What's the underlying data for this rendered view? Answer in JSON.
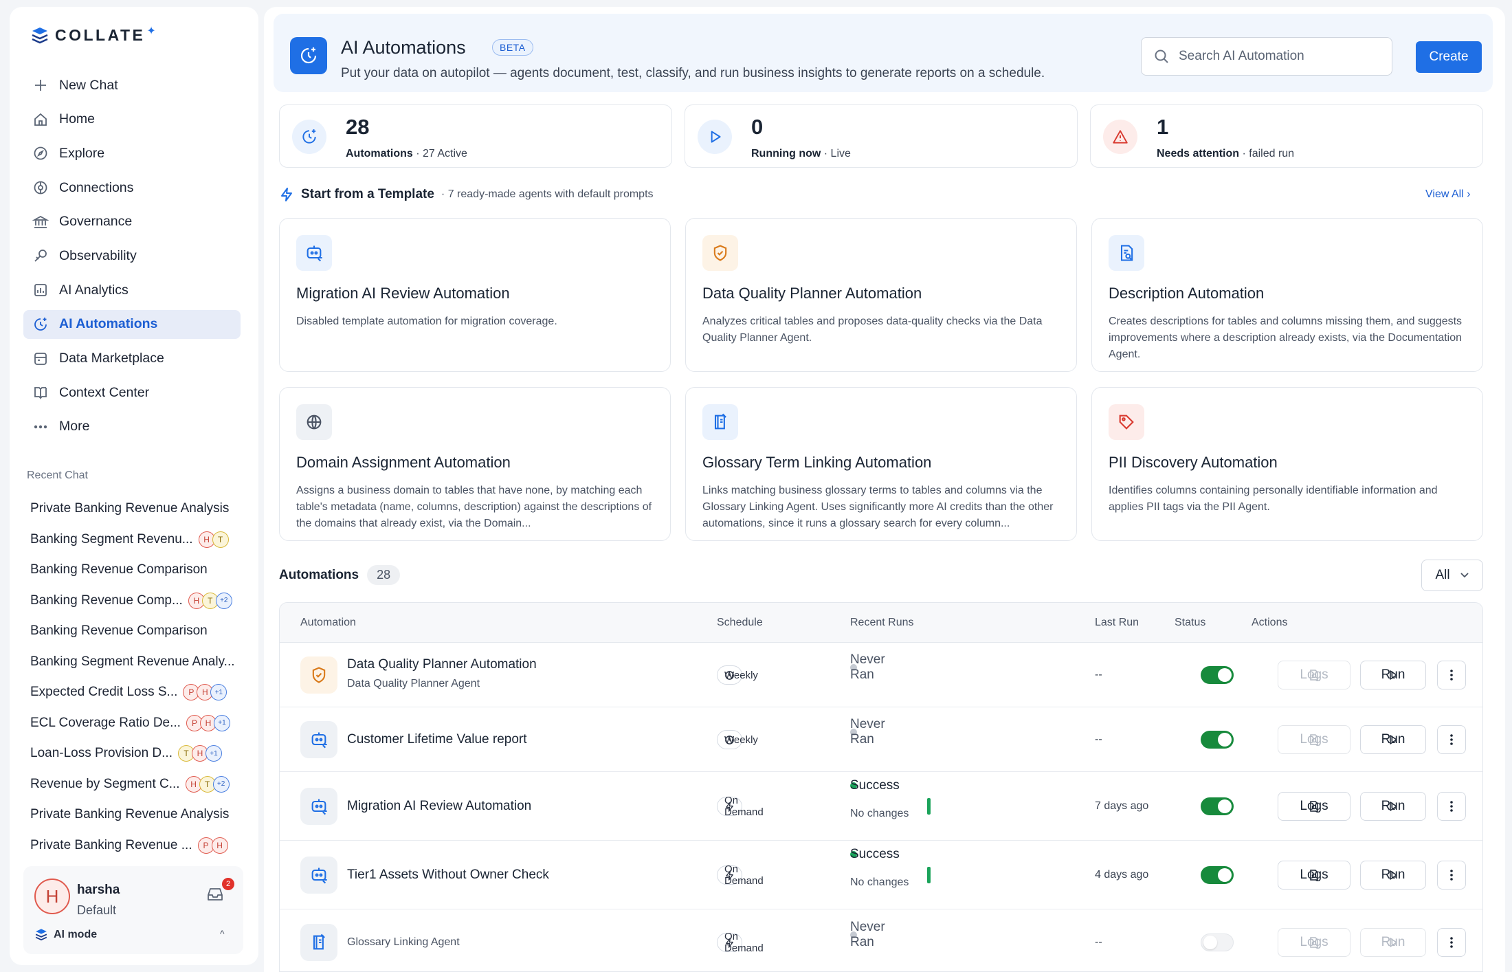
{
  "brand": {
    "name": "COLLATE",
    "star": "✦"
  },
  "nav": [
    {
      "label": "New Chat",
      "icon": "plus-icon"
    },
    {
      "label": "Home",
      "icon": "home-icon"
    },
    {
      "label": "Explore",
      "icon": "compass-icon"
    },
    {
      "label": "Connections",
      "icon": "connections-icon"
    },
    {
      "label": "Governance",
      "icon": "bank-icon"
    },
    {
      "label": "Observability",
      "icon": "telescope-icon"
    },
    {
      "label": "AI Analytics",
      "icon": "analytics-icon"
    },
    {
      "label": "AI Automations",
      "icon": "automation-clock-icon",
      "active": true
    },
    {
      "label": "Data Marketplace",
      "icon": "marketplace-icon"
    },
    {
      "label": "Context Center",
      "icon": "book-icon"
    },
    {
      "label": "More",
      "icon": "ellipsis-icon"
    }
  ],
  "recent_title": "Recent Chat",
  "recent": [
    {
      "label": "Private Banking Revenue Analysis",
      "avatars": []
    },
    {
      "label": "Banking Segment Revenu...",
      "avatars": [
        "H",
        "T"
      ]
    },
    {
      "label": "Banking Revenue Comparison",
      "avatars": []
    },
    {
      "label": "Banking Revenue Comp...",
      "avatars": [
        "H",
        "T",
        "+2"
      ]
    },
    {
      "label": "Banking Revenue Comparison",
      "avatars": []
    },
    {
      "label": "Banking Segment Revenue Analy...",
      "avatars": []
    },
    {
      "label": "Expected Credit Loss S...",
      "avatars": [
        "P",
        "H",
        "+1"
      ]
    },
    {
      "label": "ECL Coverage Ratio De...",
      "avatars": [
        "P",
        "H",
        "+1"
      ]
    },
    {
      "label": "Loan-Loss Provision D...",
      "avatars": [
        "T",
        "H",
        "+1"
      ]
    },
    {
      "label": "Revenue by Segment C...",
      "avatars": [
        "H",
        "T",
        "+2"
      ]
    },
    {
      "label": "Private Banking Revenue Analysis",
      "avatars": []
    },
    {
      "label": "Private Banking Revenue ...",
      "avatars": [
        "P",
        "H"
      ]
    }
  ],
  "user": {
    "initial": "H",
    "name": "harsha",
    "role": "Default",
    "inbox_count": "2",
    "mode": "AI mode"
  },
  "header": {
    "title": "AI Automations",
    "badge": "BETA",
    "subtitle": "Put your data on autopilot — agents document, test, classify, and run business insights to generate reports on a schedule.",
    "search_placeholder": "Search AI Automation",
    "create_label": "Create"
  },
  "stats": [
    {
      "value": "28",
      "label": "Automations",
      "detail": "· 27 Active",
      "icon": "automation-clock-icon",
      "color": "#1f6fe5",
      "bg": "#eaf2fd"
    },
    {
      "value": "0",
      "label": "Running now",
      "detail": "· Live",
      "icon": "play-icon",
      "color": "#1f6fe5",
      "bg": "#eaf2fd"
    },
    {
      "value": "1",
      "label": "Needs attention",
      "detail": "· failed run",
      "icon": "warning-icon",
      "color": "#d93a30",
      "bg": "#fdecea"
    }
  ],
  "templates_section": {
    "title": "Start from a Template",
    "subtitle": "· 7 ready-made agents with default prompts",
    "view_all": "View All"
  },
  "templates": [
    {
      "name": "Migration AI Review Automation",
      "desc": "Disabled template automation for migration coverage.",
      "icon": "bot-icon",
      "color": "#1f6fe5",
      "bg": "#eaf2fd"
    },
    {
      "name": "Data Quality Planner Automation",
      "desc": "Analyzes critical tables and proposes data-quality checks via the Data Quality Planner Agent.",
      "icon": "shield-check-icon",
      "color": "#d97a1a",
      "bg": "#fdf3e6"
    },
    {
      "name": "Description Automation",
      "desc": "Creates descriptions for tables and columns missing them, and suggests improvements where a description already exists, via the Documentation Agent.",
      "icon": "document-search-icon",
      "color": "#1f6fe5",
      "bg": "#eaf2fd"
    },
    {
      "name": "Domain Assignment Automation",
      "desc": "Assigns a business domain to tables that have none, by matching each table's metadata (name, columns, description) against the descriptions of the domains that already exist, via the Domain...",
      "icon": "globe-icon",
      "color": "#4a5363",
      "bg": "#eef1f5"
    },
    {
      "name": "Glossary Term Linking Automation",
      "desc": "Links matching business glossary terms to tables and columns via the Glossary Linking Agent. Uses significantly more AI credits than the other automations, since it runs a glossary search for every column...",
      "icon": "glossary-icon",
      "color": "#1f6fe5",
      "bg": "#eaf2fd"
    },
    {
      "name": "PII Discovery Automation",
      "desc": "Identifies columns containing personally identifiable information and applies PII tags via the PII Agent.",
      "icon": "tag-icon",
      "color": "#d93a30",
      "bg": "#fdecea"
    }
  ],
  "automations_section": {
    "title": "Automations",
    "count": "28",
    "filter": "All"
  },
  "columns": {
    "automation": "Automation",
    "schedule": "Schedule",
    "recent_runs": "Recent Runs",
    "last_run": "Last Run",
    "status": "Status",
    "actions": "Actions"
  },
  "rows": [
    {
      "name": "Data Quality Planner Automation",
      "agent": "Data Quality Planner Agent",
      "icon": "shield-check-icon",
      "color": "#d97a1a",
      "bg": "#fdf3e6",
      "schedule": "Weekly",
      "schedule_icon": "clock-icon",
      "run_state": "Never Ran",
      "run_detail": "",
      "last_run": "--",
      "enabled": true,
      "logs_enabled": false,
      "run_enabled": true
    },
    {
      "name": "Customer Lifetime Value report",
      "agent": "",
      "icon": "bot-icon",
      "color": "#1f6fe5",
      "bg": "#eef1f5",
      "schedule": "Weekly",
      "schedule_icon": "clock-icon",
      "run_state": "Never Ran",
      "run_detail": "",
      "last_run": "--",
      "enabled": true,
      "logs_enabled": false,
      "run_enabled": true
    },
    {
      "name": "Migration AI Review Automation",
      "agent": "",
      "icon": "bot-icon",
      "color": "#1f6fe5",
      "bg": "#eef1f5",
      "schedule": "On Demand",
      "schedule_icon": "bolt-icon",
      "run_state": "Success",
      "run_detail": "No changes",
      "last_run": "7 days ago",
      "enabled": true,
      "logs_enabled": true,
      "run_enabled": true
    },
    {
      "name": "Tier1 Assets Without Owner Check",
      "agent": "",
      "icon": "bot-icon",
      "color": "#1f6fe5",
      "bg": "#eef1f5",
      "schedule": "On Demand",
      "schedule_icon": "bolt-icon",
      "run_state": "Success",
      "run_detail": "No changes",
      "last_run": "4 days ago",
      "enabled": true,
      "logs_enabled": true,
      "run_enabled": true
    },
    {
      "name": "",
      "agent": "Glossary Linking Agent",
      "icon": "glossary-icon",
      "color": "#1f6fe5",
      "bg": "#eef1f5",
      "schedule": "On Demand",
      "schedule_icon": "bolt-icon",
      "run_state": "Never Ran",
      "run_detail": "",
      "last_run": "--",
      "enabled": false,
      "logs_enabled": false,
      "run_enabled": false
    }
  ],
  "action_labels": {
    "logs": "Logs",
    "run": "Run"
  }
}
